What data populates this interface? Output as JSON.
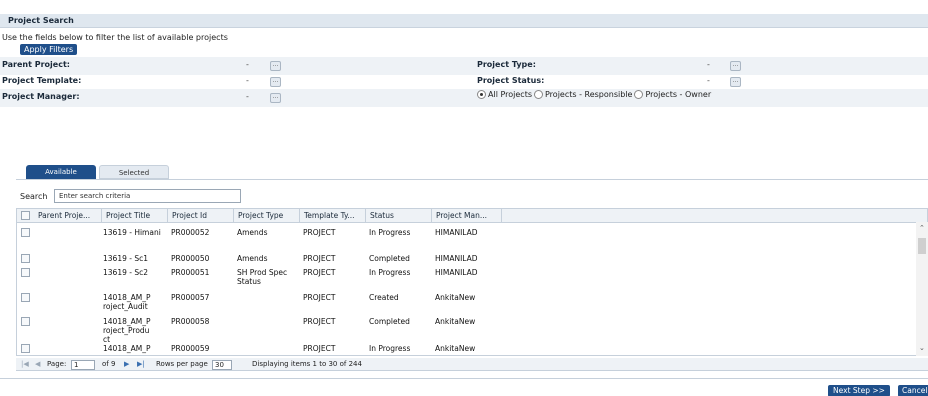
{
  "header": {
    "title": "Project Search"
  },
  "filters": {
    "instructions": "Use the fields below to filter the list of available projects",
    "apply_label": "Apply Filters",
    "parent_project": {
      "label": "Parent Project:",
      "value": "-"
    },
    "project_template": {
      "label": "Project Template:",
      "value": "-"
    },
    "project_manager": {
      "label": "Project Manager:",
      "value": "-"
    },
    "project_type": {
      "label": "Project Type:",
      "value": "-"
    },
    "project_status": {
      "label": "Project Status:",
      "value": "-"
    },
    "lookup_glyph": "...",
    "scope_options": [
      "All Projects",
      "Projects - Responsible",
      "Projects - Owner"
    ],
    "scope_selected": "All Projects"
  },
  "tabs": [
    {
      "label": "Available",
      "active": true
    },
    {
      "label": "Selected",
      "active": false
    }
  ],
  "search": {
    "label": "Search",
    "placeholder": "Enter search criteria"
  },
  "table": {
    "columns": [
      "Parent Proje...",
      "Project Title",
      "Project Id",
      "Project Type",
      "Template Ty...",
      "Status",
      "Project Man..."
    ],
    "rows": [
      {
        "parent": "",
        "title": "13619 - Himani",
        "id": "PR000052",
        "type": "Amends",
        "template": "PROJECT",
        "status": "In Progress",
        "manager": "HIMANILAD"
      },
      {
        "parent": "",
        "title": "13619 - Sc1",
        "id": "PR000050",
        "type": "Amends",
        "template": "PROJECT",
        "status": "Completed",
        "manager": "HIMANILAD"
      },
      {
        "parent": "",
        "title": "13619 - Sc2",
        "id": "PR000051",
        "type": "SH Prod Spec Status",
        "template": "PROJECT",
        "status": "In Progress",
        "manager": "HIMANILAD"
      },
      {
        "parent": "",
        "title": "14018_AM_Project_Audit",
        "id": "PR000057",
        "type": "",
        "template": "PROJECT",
        "status": "Created",
        "manager": "AnkitaNew"
      },
      {
        "parent": "",
        "title": "14018_AM_Project_Product",
        "id": "PR000058",
        "type": "",
        "template": "PROJECT",
        "status": "Completed",
        "manager": "AnkitaNew"
      },
      {
        "parent": "",
        "title": "14018_AM_P",
        "id": "PR000059",
        "type": "",
        "template": "PROJECT",
        "status": "In Progress",
        "manager": "AnkitaNew"
      }
    ]
  },
  "pager": {
    "page_label": "Page:",
    "page_value": "1",
    "of_label": "of 9",
    "rows_label": "Rows per page",
    "rows_value": "30",
    "display_text": "Displaying items 1 to 30 of 244"
  },
  "footer": {
    "next_label": "Next Step >>",
    "cancel_label": "Cancel"
  },
  "colors": {
    "accent": "#1f4f8a",
    "header_bg": "#dfe7ef",
    "row_shade": "#eef2f6"
  }
}
